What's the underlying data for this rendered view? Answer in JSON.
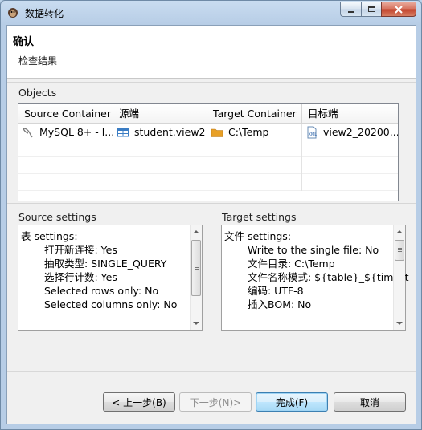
{
  "window": {
    "title": "数据转化",
    "caption_buttons": {
      "minimize_icon": "minimize-icon",
      "maximize_icon": "maximize-icon",
      "close_icon": "close-icon"
    }
  },
  "header": {
    "title": "确认",
    "subtitle": "检查结果"
  },
  "objects": {
    "label": "Objects",
    "columns": [
      "Source Container",
      "源端",
      "Target Container",
      "目标端"
    ],
    "rows": [
      {
        "source_container": "MySQL 8+ - l...",
        "source": "student.view2",
        "target_container": "C:\\Temp",
        "target": "view2_20200..."
      }
    ]
  },
  "source_settings": {
    "label": "Source settings",
    "heading": "表 settings:",
    "lines": [
      "打开新连接: Yes",
      "抽取类型: SINGLE_QUERY",
      "选择行计数: Yes",
      "Selected rows only: No",
      "Selected columns only: No"
    ]
  },
  "target_settings": {
    "label": "Target settings",
    "heading": "文件 settings:",
    "lines": [
      "Write to the single file: No",
      "文件目录: C:\\Temp",
      "文件名称模式: ${table}_${timest",
      "编码: UTF-8",
      "插入BOM: No"
    ]
  },
  "buttons": {
    "back": "< 上一步(B)",
    "next": "下一步(N)>",
    "finish": "完成(F)",
    "cancel": "取消"
  },
  "colors": {
    "accent": "#3c7fb1",
    "folder": "#e8a026",
    "table_icon": "#3b7dc4"
  }
}
